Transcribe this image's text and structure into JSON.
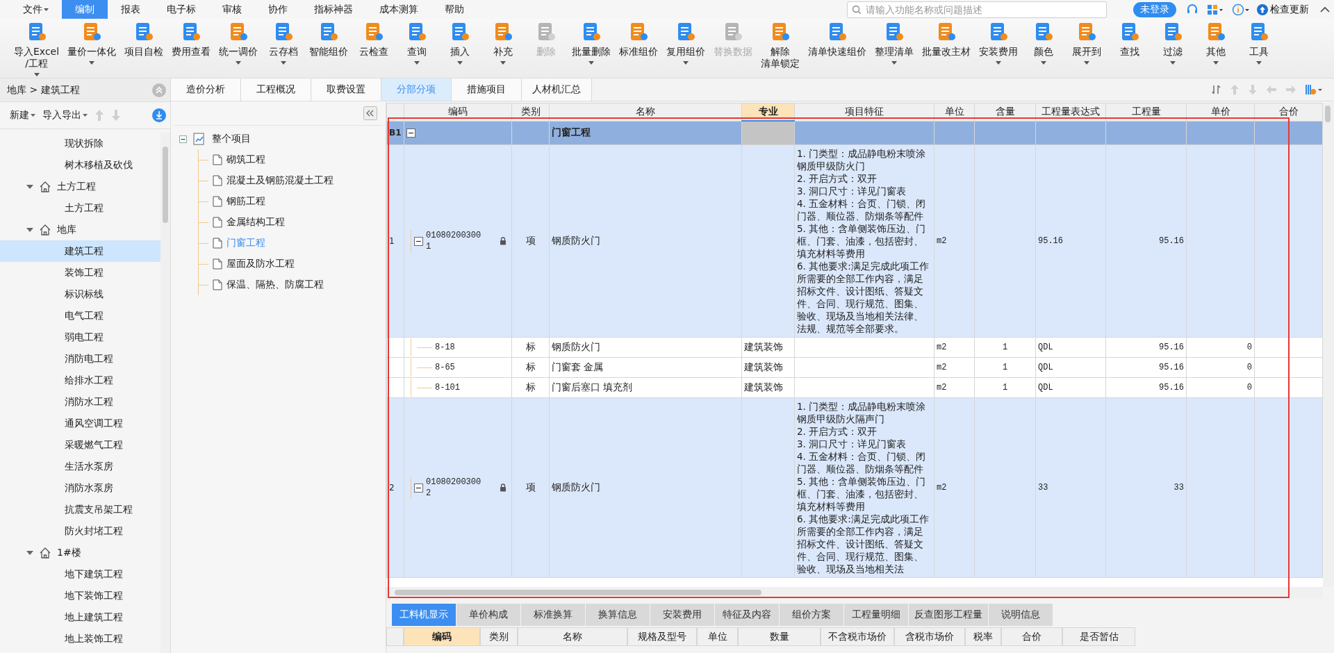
{
  "menu": [
    {
      "label": "文件",
      "caret": true,
      "selected": false
    },
    {
      "label": "编制",
      "caret": false,
      "selected": true
    },
    {
      "label": "报表",
      "caret": false,
      "selected": false
    },
    {
      "label": "电子标",
      "caret": false,
      "selected": false
    },
    {
      "label": "审核",
      "caret": false,
      "selected": false
    },
    {
      "label": "协作",
      "caret": false,
      "selected": false
    },
    {
      "label": "指标神器",
      "caret": false,
      "selected": false
    },
    {
      "label": "成本测算",
      "caret": false,
      "selected": false
    },
    {
      "label": "帮助",
      "caret": false,
      "selected": false
    }
  ],
  "search": {
    "placeholder": "请输入功能名称或问题描述"
  },
  "login_button": "未登录",
  "update_button": "检查更新",
  "toolbar": [
    {
      "lines": [
        "导入Excel",
        "/工程"
      ],
      "caret": true,
      "disabled": false
    },
    {
      "lines": [
        "量价一体化"
      ],
      "caret": true,
      "disabled": false
    },
    {
      "lines": [
        "项目自检"
      ],
      "caret": false,
      "disabled": false
    },
    {
      "lines": [
        "费用查看"
      ],
      "caret": false,
      "disabled": false
    },
    {
      "lines": [
        "统一调价"
      ],
      "caret": true,
      "disabled": false
    },
    {
      "lines": [
        "云存档"
      ],
      "caret": true,
      "disabled": false
    },
    {
      "lines": [
        "智能组价"
      ],
      "caret": false,
      "disabled": false
    },
    {
      "lines": [
        "云检查"
      ],
      "caret": false,
      "disabled": false
    },
    {
      "lines": [
        "查询"
      ],
      "caret": true,
      "disabled": false
    },
    {
      "lines": [
        "插入"
      ],
      "caret": true,
      "disabled": false
    },
    {
      "lines": [
        "补充"
      ],
      "caret": true,
      "disabled": false
    },
    {
      "lines": [
        "删除"
      ],
      "caret": false,
      "disabled": true
    },
    {
      "lines": [
        "批量删除"
      ],
      "caret": true,
      "disabled": false
    },
    {
      "lines": [
        "标准组价"
      ],
      "caret": false,
      "disabled": false
    },
    {
      "lines": [
        "复用组价"
      ],
      "caret": true,
      "disabled": false
    },
    {
      "lines": [
        "替换数据"
      ],
      "caret": false,
      "disabled": true
    },
    {
      "lines": [
        "解除",
        "清单锁定"
      ],
      "caret": false,
      "disabled": false
    },
    {
      "lines": [
        "清单快速组价"
      ],
      "caret": false,
      "disabled": false
    },
    {
      "lines": [
        "整理清单"
      ],
      "caret": true,
      "disabled": false
    },
    {
      "lines": [
        "批量改主材"
      ],
      "caret": false,
      "disabled": false
    },
    {
      "lines": [
        "安装费用"
      ],
      "caret": true,
      "disabled": false
    },
    {
      "lines": [
        "颜色"
      ],
      "caret": true,
      "disabled": false
    },
    {
      "lines": [
        "展开到"
      ],
      "caret": true,
      "disabled": false
    },
    {
      "lines": [
        "查找"
      ],
      "caret": false,
      "disabled": false
    },
    {
      "lines": [
        "过滤"
      ],
      "caret": true,
      "disabled": false
    },
    {
      "lines": [
        "其他"
      ],
      "caret": true,
      "disabled": false
    },
    {
      "lines": [
        "工具"
      ],
      "caret": true,
      "disabled": false
    }
  ],
  "sidebar": {
    "breadcrumb": "地库 > 建筑工程",
    "new_button": "新建",
    "import_export_button": "导入导出",
    "items": [
      {
        "label": "现状拆除",
        "selected": false
      },
      {
        "label": "树木移植及砍伐",
        "selected": false
      },
      {
        "label": "土方工程",
        "selected": false,
        "expanded": true,
        "children": [
          {
            "label": "土方工程",
            "selected": false
          }
        ]
      },
      {
        "label": "地库",
        "selected": false,
        "expanded": true,
        "children": [
          {
            "label": "建筑工程",
            "selected": true
          },
          {
            "label": "装饰工程",
            "selected": false
          },
          {
            "label": "标识标线",
            "selected": false
          },
          {
            "label": "电气工程",
            "selected": false
          },
          {
            "label": "弱电工程",
            "selected": false
          },
          {
            "label": "消防电工程",
            "selected": false
          },
          {
            "label": "给排水工程",
            "selected": false
          },
          {
            "label": "消防水工程",
            "selected": false
          },
          {
            "label": "通风空调工程",
            "selected": false
          },
          {
            "label": "采暖燃气工程",
            "selected": false
          },
          {
            "label": "生活水泵房",
            "selected": false
          },
          {
            "label": "消防水泵房",
            "selected": false
          },
          {
            "label": "抗震支吊架工程",
            "selected": false
          },
          {
            "label": "防火封堵工程",
            "selected": false
          }
        ]
      },
      {
        "label": "1#楼",
        "selected": false,
        "expanded": true,
        "children": [
          {
            "label": "地下建筑工程",
            "selected": false
          },
          {
            "label": "地下装饰工程",
            "selected": false
          },
          {
            "label": "地上建筑工程",
            "selected": false
          },
          {
            "label": "地上装饰工程",
            "selected": false
          }
        ]
      }
    ]
  },
  "tabs": [
    {
      "label": "造价分析",
      "selected": false
    },
    {
      "label": "工程概况",
      "selected": false
    },
    {
      "label": "取费设置",
      "selected": false
    },
    {
      "label": "分部分项",
      "selected": true
    },
    {
      "label": "措施项目",
      "selected": false
    },
    {
      "label": "人材机汇总",
      "selected": false
    }
  ],
  "project_tree": {
    "label": "整个项目",
    "expanded": true,
    "children": [
      {
        "label": "砌筑工程",
        "selected": false
      },
      {
        "label": "混凝土及钢筋混凝土工程",
        "selected": false
      },
      {
        "label": "钢筋工程",
        "selected": false
      },
      {
        "label": "金属结构工程",
        "selected": false
      },
      {
        "label": "门窗工程",
        "selected": true
      },
      {
        "label": "屋面及防水工程",
        "selected": false
      },
      {
        "label": "保温、隔热、防腐工程",
        "selected": false
      }
    ]
  },
  "table": {
    "columns": [
      {
        "label": "编码",
        "selected": false
      },
      {
        "label": "类别",
        "selected": false
      },
      {
        "label": "名称",
        "selected": false
      },
      {
        "label": "专业",
        "selected": true
      },
      {
        "label": "项目特征",
        "selected": false
      },
      {
        "label": "单位",
        "selected": false
      },
      {
        "label": "含量",
        "selected": false
      },
      {
        "label": "工程量表达式",
        "selected": false
      },
      {
        "label": "工程量",
        "selected": false
      },
      {
        "label": "单价",
        "selected": false
      },
      {
        "label": "合价",
        "selected": false
      }
    ],
    "rows": [
      {
        "kind": "section",
        "number": "B1",
        "expanded": true,
        "name": "门窗工程"
      },
      {
        "kind": "item",
        "number": "1",
        "code": "010802003001",
        "expanded": true,
        "locked": true,
        "type": "项",
        "name": "钢质防火门",
        "features": [
          "1. 门类型：成品静电粉末喷涂钢质甲级防火门",
          "2. 开启方式：双开",
          "3. 洞口尺寸：详见门窗表",
          "4. 五金材料：合页、门锁、闭门器、顺位器、防烟条等配件",
          "5. 其他：含单侧装饰压边、门框、门套、油漆，包括密封、填充材料等费用",
          "6. 其他要求:满足完成此项工作所需要的全部工作内容，满足招标文件、设计图纸、答疑文件、合同、现行规范、图集、验收、现场及当地相关法律、法规、规范等全部要求。"
        ],
        "unit": "m2",
        "expression": "95.16",
        "quantity": "95.16"
      },
      {
        "kind": "sub",
        "code": "8-18",
        "type": "标",
        "name": "钢质防火门",
        "major": "建筑装饰",
        "unit": "m2",
        "content": "1",
        "expression": "QDL",
        "quantity": "95.16",
        "unit_price": "0"
      },
      {
        "kind": "sub",
        "code": "8-65",
        "type": "标",
        "name": "门窗套 金属",
        "major": "建筑装饰",
        "unit": "m2",
        "content": "1",
        "expression": "QDL",
        "quantity": "95.16",
        "unit_price": "0"
      },
      {
        "kind": "sub",
        "code": "8-101",
        "type": "标",
        "name": "门窗后塞口 填充剂",
        "major": "建筑装饰",
        "unit": "m2",
        "content": "1",
        "expression": "QDL",
        "quantity": "95.16",
        "unit_price": "0"
      },
      {
        "kind": "item",
        "number": "2",
        "code": "010802003002",
        "expanded": true,
        "locked": true,
        "type": "项",
        "name": "钢质防火门",
        "features": [
          "1. 门类型：成品静电粉末喷涂钢质甲级防火隔声门",
          "2. 开启方式：双开",
          "3. 洞口尺寸：详见门窗表",
          "4. 五金材料：合页、门锁、闭门器、顺位器、防烟条等配件",
          "5. 其他：含单侧装饰压边、门框、门套、油漆，包括密封、填充材料等费用",
          "6. 其他要求:满足完成此项工作所需要的全部工作内容，满足招标文件、设计图纸、答疑文件、合同、现行规范、图集、验收、现场及当地相关法"
        ],
        "unit": "m2",
        "expression": "33",
        "quantity": "33"
      }
    ]
  },
  "highlight_frame": true,
  "bottom_tabs": [
    {
      "label": "工料机显示",
      "selected": true
    },
    {
      "label": "单价构成",
      "selected": false
    },
    {
      "label": "标准换算",
      "selected": false
    },
    {
      "label": "换算信息",
      "selected": false
    },
    {
      "label": "安装费用",
      "selected": false
    },
    {
      "label": "特征及内容",
      "selected": false
    },
    {
      "label": "组价方案",
      "selected": false
    },
    {
      "label": "工程量明细",
      "selected": false
    },
    {
      "label": "反查图形工程量",
      "selected": false
    },
    {
      "label": "说明信息",
      "selected": false
    }
  ],
  "bottom_columns": [
    {
      "label": "编码",
      "selected": true
    },
    {
      "label": "类别",
      "selected": false
    },
    {
      "label": "名称",
      "selected": false
    },
    {
      "label": "规格及型号",
      "selected": false
    },
    {
      "label": "单位",
      "selected": false
    },
    {
      "label": "数量",
      "selected": false
    },
    {
      "label": "不含税市场价",
      "selected": false
    },
    {
      "label": "含税市场价",
      "selected": false
    },
    {
      "label": "税率",
      "selected": false
    },
    {
      "label": "合价",
      "selected": false
    },
    {
      "label": "是否暂估",
      "selected": false
    }
  ]
}
